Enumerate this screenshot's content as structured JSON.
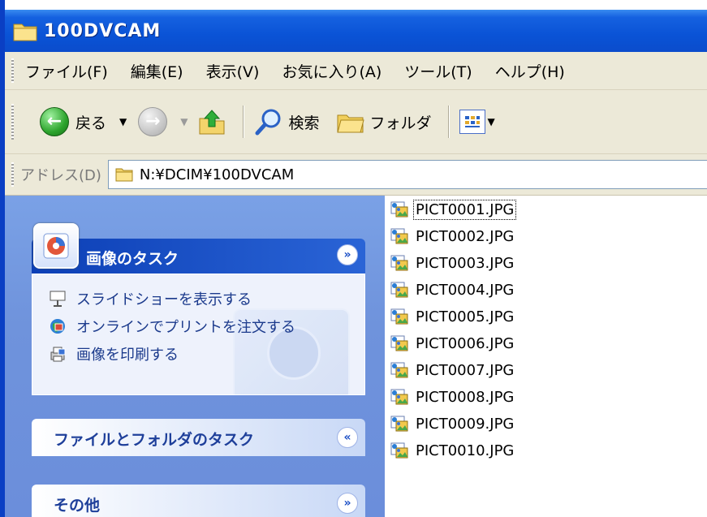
{
  "window": {
    "title": "100DVCAM"
  },
  "menu": [
    "ファイル(F)",
    "編集(E)",
    "表示(V)",
    "お気に入り(A)",
    "ツール(T)",
    "ヘルプ(H)"
  ],
  "toolbar": {
    "back_label": "戻る",
    "search_label": "検索",
    "folders_label": "フォルダ"
  },
  "address": {
    "label": "アドレス(D)",
    "value": "N:¥DCIM¥100DVCAM"
  },
  "taskpane": {
    "picture_tasks": {
      "title": "画像のタスク",
      "items": [
        {
          "label": "スライドショーを表示する",
          "icon": "slideshow-icon"
        },
        {
          "label": "オンラインでプリントを注文する",
          "icon": "online-print-icon"
        },
        {
          "label": "画像を印刷する",
          "icon": "printer-icon"
        }
      ]
    },
    "file_folder_tasks": {
      "title": "ファイルとフォルダのタスク"
    },
    "other": {
      "title": "その他"
    }
  },
  "files": [
    "PICT0001.JPG",
    "PICT0002.JPG",
    "PICT0003.JPG",
    "PICT0004.JPG",
    "PICT0005.JPG",
    "PICT0006.JPG",
    "PICT0007.JPG",
    "PICT0008.JPG",
    "PICT0009.JPG",
    "PICT0010.JPG"
  ],
  "colors": {
    "titlebar": "#0a53d6",
    "taskpane": "#6f93dc",
    "chrome": "#ece9d8"
  }
}
